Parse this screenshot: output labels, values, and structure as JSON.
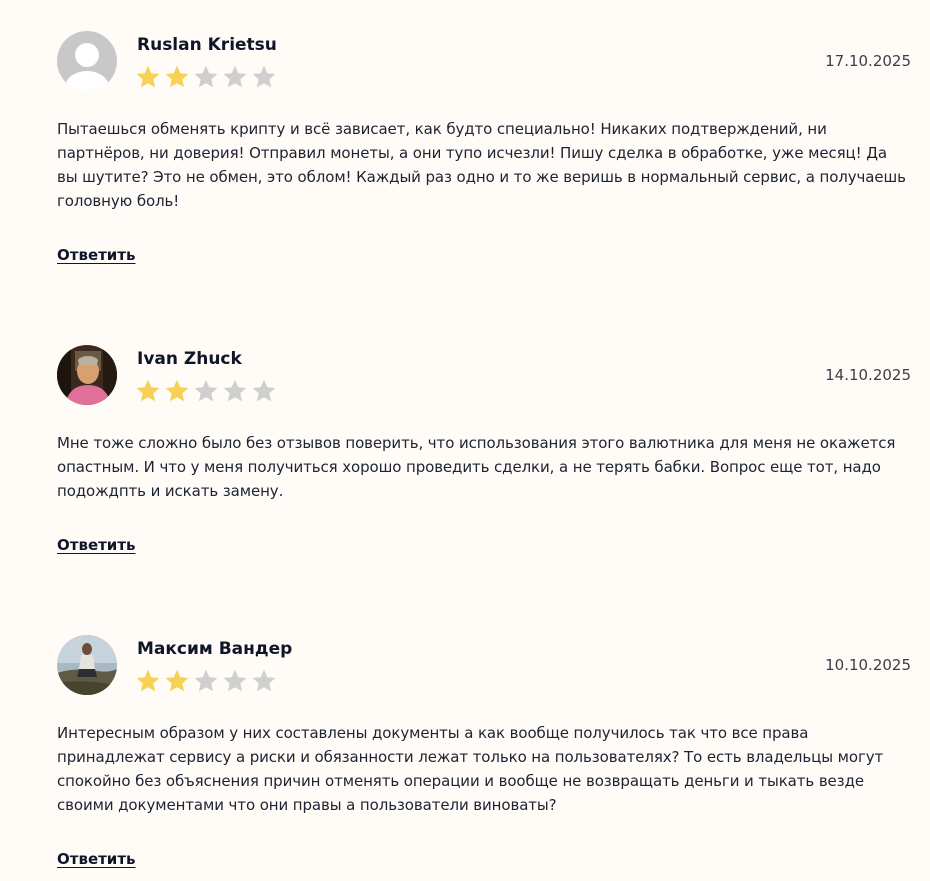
{
  "colors": {
    "background": "#fffbf7",
    "star_filled": "#f6d155",
    "star_empty": "#cfcfcf",
    "text": "#1d2333"
  },
  "reviews": [
    {
      "author": "Ruslan Krietsu",
      "date": "17.10.2025",
      "rating": 2,
      "max_rating": 5,
      "avatar": "default-avatar-icon",
      "text": "Пытаешься обменять крипту и всё зависает, как будто специально! Никаких подтверждений, ни партнёров, ни доверия! Отправил монеты, а они тупо исчезли! Пишу сделка в обработке, уже месяц! Да вы шутите? Это не обмен, это облом! Каждый раз одно и то же веришь в нормальный сервис, а получаешь головную боль!",
      "reply_label": "Ответить"
    },
    {
      "author": "Ivan Zhuck",
      "date": "14.10.2025",
      "rating": 2,
      "max_rating": 5,
      "avatar": "user-photo",
      "text": "Мне тоже сложно было без отзывов поверить, что использования этого валютника для меня не окажется опастным. И что у меня получиться хорошо проведить сделки, а не терять бабки. Вопрос еще тот, надо подождпть и искать замену.",
      "reply_label": "Ответить"
    },
    {
      "author": "Максим Вандер",
      "date": "10.10.2025",
      "rating": 2,
      "max_rating": 5,
      "avatar": "user-photo",
      "text": "Интересным образом у них составлены документы а как вообще получилось так что все права принадлежат сервису а риски и обязанности лежат только на пользователях? То есть владельцы могут спокойно без объяснения причин отменять операции и вообще не возвращать деньги и тыкать везде своими документами что они правы а пользователи виноваты?",
      "reply_label": "Ответить"
    }
  ]
}
